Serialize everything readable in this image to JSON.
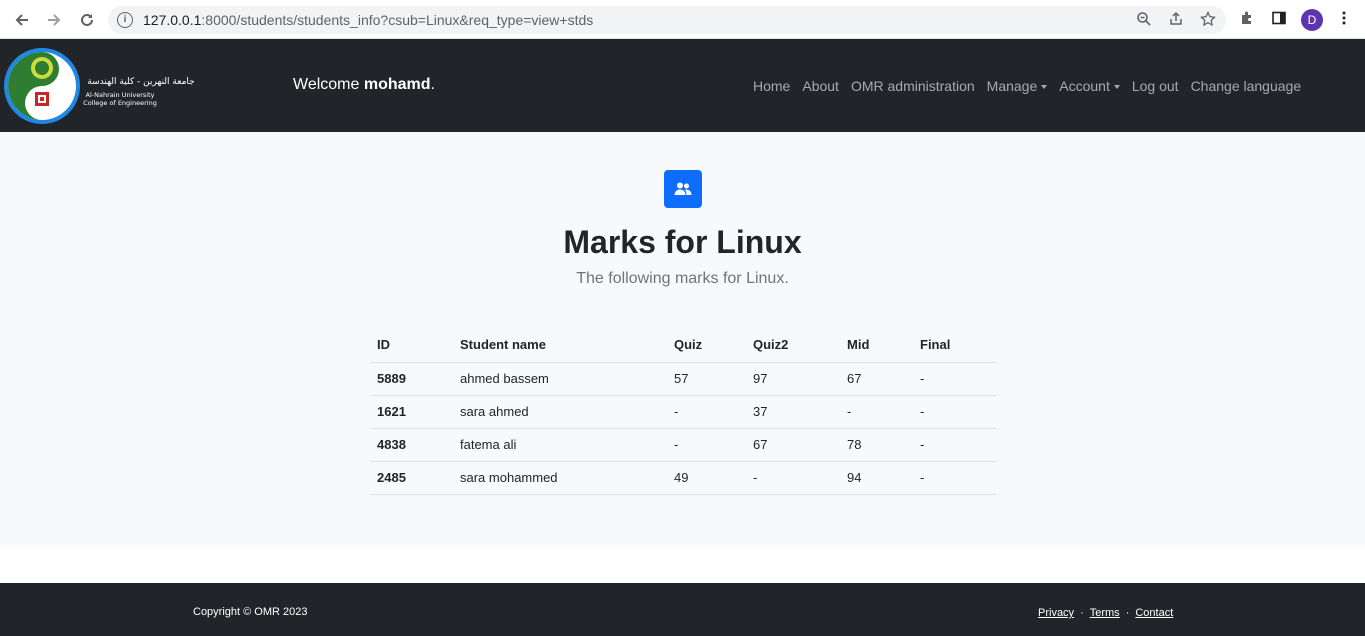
{
  "browser": {
    "url_host": "127.0.0.1",
    "url_rest": ":8000/students/students_info?csub=Linux&req_type=view+stds",
    "profile_initial": "D"
  },
  "navbar": {
    "logo_text_ar": "جامعة النهرين - كلية الهندسة",
    "logo_text_en1": "Al-Nahrain University",
    "logo_text_en2": "College of Engineering",
    "welcome_prefix": "Welcome ",
    "welcome_user": "mohamd",
    "welcome_suffix": ".",
    "links": {
      "home": "Home",
      "about": "About",
      "omr_admin": "OMR administration",
      "manage": "Manage",
      "account": "Account",
      "logout": "Log out",
      "language": "Change language"
    }
  },
  "main": {
    "title": "Marks for Linux",
    "subtitle": "The following marks for Linux.",
    "columns": [
      "ID",
      "Student name",
      "Quiz",
      "Quiz2",
      "Mid",
      "Final"
    ],
    "rows": [
      [
        "5889",
        "ahmed bassem",
        "57",
        "97",
        "67",
        "-"
      ],
      [
        "1621",
        "sara ahmed",
        "-",
        "37",
        "-",
        "-"
      ],
      [
        "4838",
        "fatema ali",
        "-",
        "67",
        "78",
        "-"
      ],
      [
        "2485",
        "sara mohammed",
        "49",
        "-",
        "94",
        "-"
      ]
    ]
  },
  "footer": {
    "copyright": "Copyright © OMR 2023",
    "privacy": "Privacy",
    "terms": "Terms",
    "contact": "Contact",
    "separator": "·"
  },
  "colors": {
    "navbar_bg": "#212529",
    "accent": "#0d6efd",
    "page_bg": "#f8f9fa"
  }
}
